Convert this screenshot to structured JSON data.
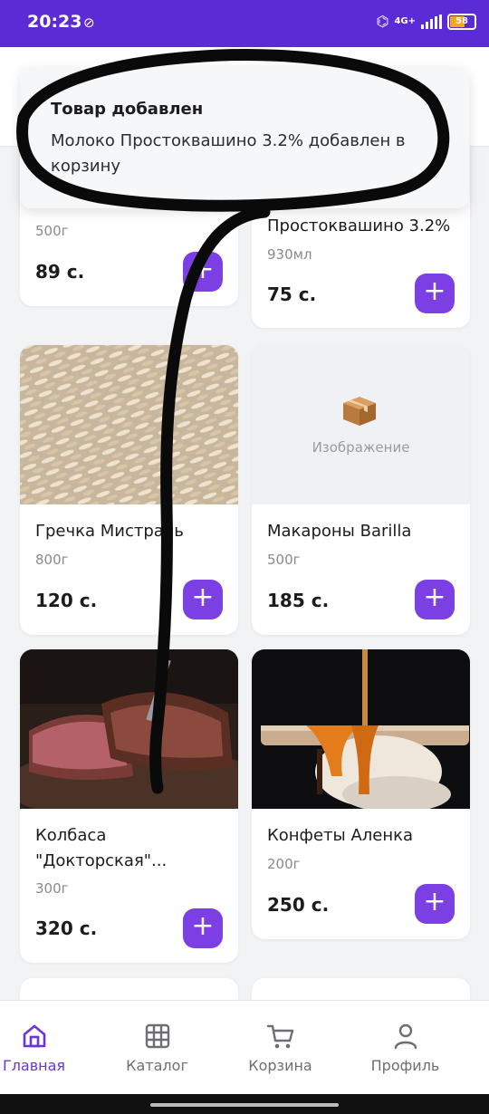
{
  "status_bar": {
    "time": "20:23",
    "network": "4G+",
    "battery": "58"
  },
  "toast": {
    "title": "Товар добавлен",
    "message": "Молоко Простоквашино 3.2% добавлен в корзину"
  },
  "products": [
    {
      "name": "",
      "weight": "500г",
      "price": "89 с.",
      "image": "none"
    },
    {
      "name": "Простоквашино 3.2%",
      "weight": "930мл",
      "price": "75 с.",
      "image": "none"
    },
    {
      "name": "Гречка Мистраль",
      "weight": "800г",
      "price": "120 с.",
      "image": "grain"
    },
    {
      "name": "Макароны Barilla",
      "weight": "500г",
      "price": "185 с.",
      "image": "placeholder",
      "placeholder_label": "Изображение"
    },
    {
      "name": "Колбаса \"Докторская\"...",
      "weight": "300г",
      "price": "320 с.",
      "image": "meat"
    },
    {
      "name": "Конфеты Аленка",
      "weight": "200г",
      "price": "250 с.",
      "image": "dessert"
    }
  ],
  "add_button_label": "+",
  "bottom_nav": [
    {
      "label": "Главная",
      "icon": "home-icon",
      "active": true
    },
    {
      "label": "Каталог",
      "icon": "grid-icon",
      "active": false
    },
    {
      "label": "Корзина",
      "icon": "cart-icon",
      "active": false
    },
    {
      "label": "Профиль",
      "icon": "profile-icon",
      "active": false
    }
  ],
  "colors": {
    "accent": "#7b3fe4",
    "status_bar": "#5b2bd6",
    "nav_active": "#6a35d6"
  }
}
